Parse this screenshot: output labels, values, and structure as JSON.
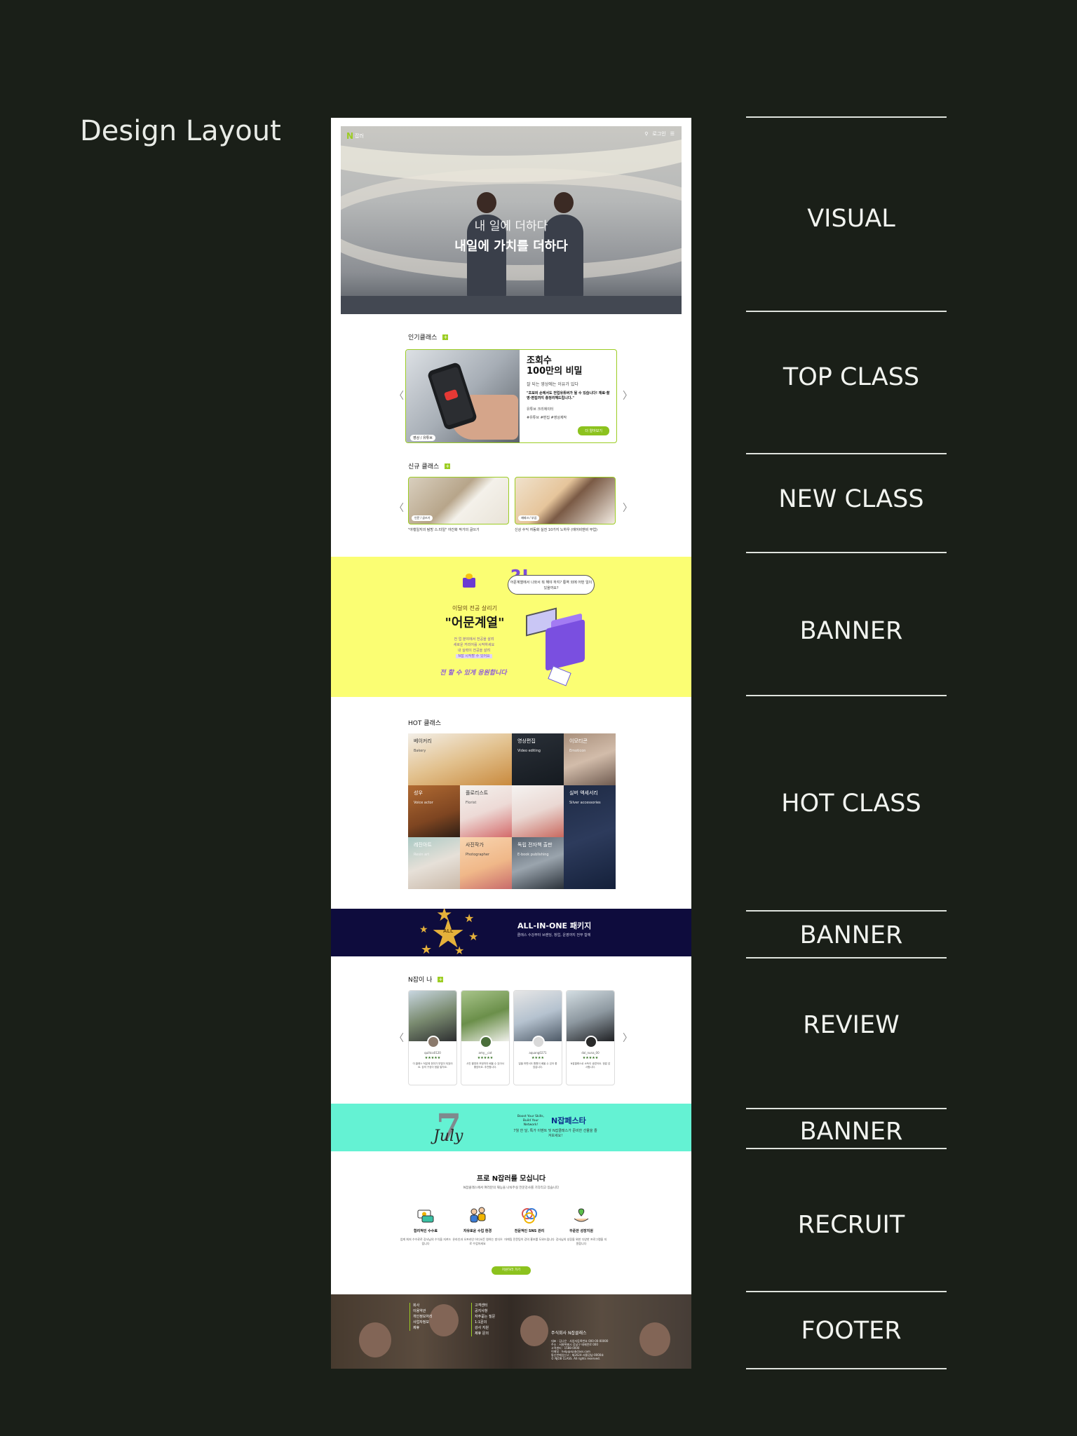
{
  "page": {
    "title": "Design Layout"
  },
  "sections": [
    "VISUAL",
    "TOP CLASS",
    "NEW CLASS",
    "BANNER",
    "HOT CLASS",
    "BANNER",
    "REVIEW",
    "BANNER",
    "RECRUIT",
    "FOOTER"
  ],
  "visual": {
    "logo": "N",
    "logo_sub": "잡러",
    "util_label": "로그인",
    "headline_1": "내 일에 더하다",
    "headline_2": "내일에 가치를 더하다"
  },
  "top_class": {
    "title": "인기클래스",
    "plus": "+",
    "prev": "〈",
    "next": "〉",
    "card": {
      "tag": "영상 / 유튜브",
      "heading_1": "조회수",
      "heading_2": "100만의 비밀",
      "subtitle": "잘 되는 영상에는 이유가 있다",
      "quote": "\"초보의 손에서도 전업유튜버가 될 수 있습니다! 재료·촬영·편집까지 총정리해드립니다.\"",
      "instructor": "유튜브 크리에이터",
      "tags": "#유튜브 #편집 #영상제작",
      "button": "더 알아보기"
    }
  },
  "new_class": {
    "title": "신규 클래스",
    "plus": "+",
    "prev": "〈",
    "next": "〉",
    "items": [
      {
        "tag": "인문 / 글쓰기",
        "caption": "\"야행일지의 탐방 스.타일\" 야간화 작가의 글쓰기",
        "sub": ""
      },
      {
        "tag": "재테크 / 부업",
        "caption": "신상 수익 자동화 실전 10가지 노하우 (에어비앤비 부업)",
        "sub": ""
      }
    ]
  },
  "banner_1": {
    "small": "이달의 전공 살리기",
    "big": "\"어문계열\"",
    "desc_1": "전 업 분야에서 전공을 살려",
    "desc_2": "새로운 커리어를 시작하세요",
    "desc_3": "내 실력이 전공을 살려",
    "highlight": "N잡 시작할 수 있어요",
    "slogan": "전 할 수 있게 응원합니다",
    "bubble": "어문계열에서 나와서 뭐 해야 하지? 통역 외에 어떤 일이 있을까요?"
  },
  "hot_class": {
    "title": "HOT 클래스",
    "items": [
      {
        "ko": "베이커리",
        "en": "Bakery"
      },
      {
        "ko": "영상편집",
        "en": "Video editing"
      },
      {
        "ko": "이모티콘",
        "en": "Emoticon"
      },
      {
        "ko": "성우",
        "en": "Voice actor"
      },
      {
        "ko": "플로리스트",
        "en": "Florist"
      },
      {
        "ko": "실버 액세서리",
        "en": "Silver accessories"
      },
      {
        "ko": "레진아트",
        "en": "Resin art"
      },
      {
        "ko": "사진작가",
        "en": "Photographer"
      },
      {
        "ko": "독립 전자책 출판",
        "en": "E-book publishing"
      }
    ]
  },
  "banner_2": {
    "badge": "ALL",
    "title": "ALL-IN-ONE 패키지",
    "desc": "클래스 수강부터 브랜딩, 창업, 운영까지 전부 함께"
  },
  "review": {
    "title": "N잡이 나",
    "plus": "+",
    "prev": "〈",
    "next": "〉",
    "items": [
      {
        "name": "quiltco0120",
        "stars": "★★★★★",
        "text": "이 클래스 덕분에 취미가 부업이 되었어요. 강의 구성이 정말 알차요."
      },
      {
        "name": "amy__cat",
        "stars": "★★★★★",
        "text": "사진 촬영과 보정까지 배울 수 있어서 좋았어요. 추천합니다."
      },
      {
        "name": "aquang0271",
        "stars": "★★★★",
        "text": "일을 하면서도 틈틈이 배울 수 있어 좋았습니다."
      },
      {
        "name": "dal_nuna_00",
        "stars": "★★★★★",
        "text": "N잡클래스로 소득이 생겼어요. 정말 감사합니다."
      }
    ]
  },
  "banner_3": {
    "number": "7",
    "month": "July",
    "small": "Boost Your Skills, Build Your Network!",
    "big": "N잡페스타",
    "desc": "7월 한 달, 특가 이벤트 및 N잡클래스가 준비한 선물을 즐겨보세요!"
  },
  "recruit": {
    "title": "프로 N잡러를 모십니다",
    "subtitle": "N잡클래스에서 여러분의 재능을 나눠주실 전문강사를 기다리고 있습니다",
    "items": [
      {
        "title": "합리적인 수수료",
        "desc": "업계 최저 수수료로 강사님의 수익을 지켜드립니다"
      },
      {
        "title": "자유로운 수업 환경",
        "desc": "온라인과 오프라인 어디서든 원하는 방식으로 수업하세요"
      },
      {
        "title": "전문적인 SNS 관리",
        "desc": "마케팅 전문팀이 강의 홍보를 도와드립니다"
      },
      {
        "title": "꾸준한 성장지원",
        "desc": "강사님의 성장을 위한 다양한 프로그램을 지원합니다"
      }
    ],
    "button": "지원하러 가기"
  },
  "footer": {
    "col_1": [
      "회사",
      "이용약관",
      "개인정보처리",
      "사업자정보",
      "제휴"
    ],
    "col_2": [
      "고객센터",
      "공지사항",
      "자주묻는 질문",
      "1:1문의",
      "강사 지원",
      "제휴 문의"
    ],
    "company": "주식회사 N잡클래스",
    "info": [
      "대표 : 김나은 · 사업자등록번호 000-00-00000",
      "주소 : 서울특별시 강남구 테헤란로 000",
      "고객센터 : 1588-0000",
      "이메일 : help@njobclass.com",
      "통신판매업신고 : 제2024-서울강남-0000호",
      "© NJOB CLASS. All rights reserved."
    ]
  },
  "colors": {
    "background": "#1a1f18",
    "accent_green": "#9ccd23",
    "banner_yellow": "#fbfe73",
    "banner_navy": "#0e0c3d",
    "banner_mint": "#64f2d3"
  }
}
